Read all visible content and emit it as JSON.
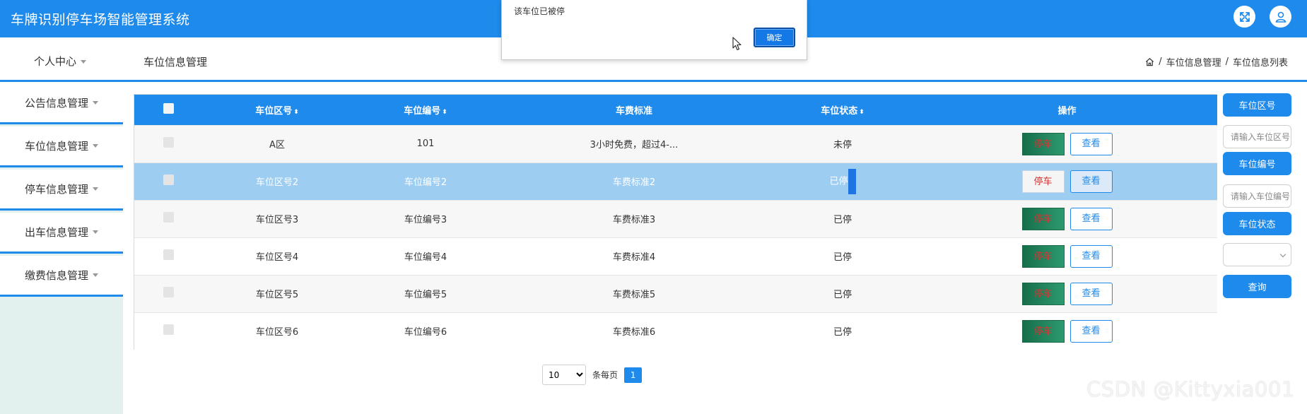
{
  "header": {
    "app_title": "车牌识别停车场智能管理系统",
    "icons": [
      "fullscreen-icon",
      "user-icon"
    ]
  },
  "subbar": {
    "personal_center": "个人中心",
    "page_title": "车位信息管理",
    "breadcrumb": [
      "车位信息管理",
      "车位信息列表"
    ],
    "breadcrumb_sep": "/"
  },
  "sidebar": {
    "items": [
      {
        "label": "公告信息管理"
      },
      {
        "label": "车位信息管理"
      },
      {
        "label": "停车信息管理"
      },
      {
        "label": "出车信息管理"
      },
      {
        "label": "缴费信息管理"
      }
    ]
  },
  "table": {
    "headers": [
      "车位区号",
      "车位编号",
      "车费标准",
      "车位状态",
      "操作"
    ],
    "sort_glyph": "⬍",
    "rows": [
      {
        "zone": "A区",
        "number": "101",
        "fee": "3小时免费，超过4-...",
        "status": "未停",
        "park": "停车",
        "view": "查看"
      },
      {
        "zone": "车位区号2",
        "number": "车位编号2",
        "fee": "车费标准2",
        "status": "已停",
        "park": "停车",
        "view": "查看"
      },
      {
        "zone": "车位区号3",
        "number": "车位编号3",
        "fee": "车费标准3",
        "status": "已停",
        "park": "停车",
        "view": "查看"
      },
      {
        "zone": "车位区号4",
        "number": "车位编号4",
        "fee": "车费标准4",
        "status": "已停",
        "park": "停车",
        "view": "查看"
      },
      {
        "zone": "车位区号5",
        "number": "车位编号5",
        "fee": "车费标准5",
        "status": "已停",
        "park": "停车",
        "view": "查看"
      },
      {
        "zone": "车位区号6",
        "number": "车位编号6",
        "fee": "车费标准6",
        "status": "已停",
        "park": "停车",
        "view": "查看"
      }
    ],
    "selected_row": 2
  },
  "pagination": {
    "page_size": "10",
    "page_size_label": "条每页",
    "current_page": "1"
  },
  "search": {
    "zone_label": "车位区号",
    "zone_placeholder": "请输入车位区号",
    "number_label": "车位编号",
    "number_placeholder": "请输入车位编号",
    "status_label": "车位状态",
    "status_value": "",
    "query_label": "查询"
  },
  "alert": {
    "message": "该车位已被停",
    "ok_label": "确定"
  },
  "watermark": "CSDN @Kittyxia001",
  "colors": {
    "primary": "#1e8aeb",
    "sidebar_bg": "#e3f1ee",
    "park_button": "#1f7f58",
    "selected_row": "#9ecdf2"
  }
}
